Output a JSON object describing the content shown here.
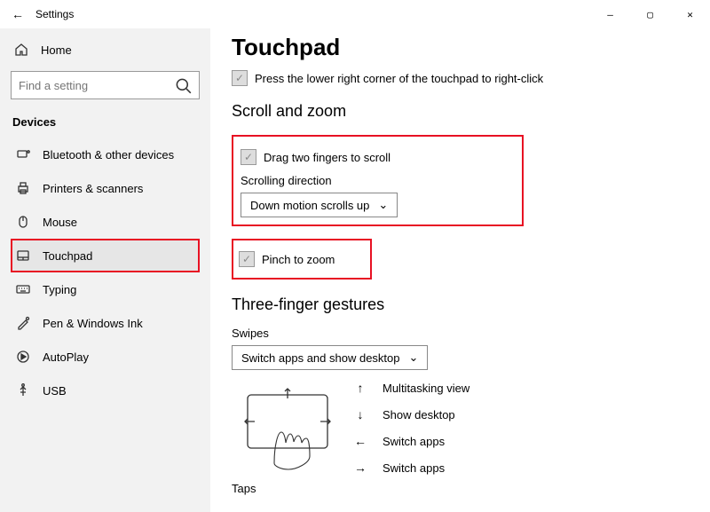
{
  "window": {
    "title": "Settings"
  },
  "sidebar": {
    "home": "Home",
    "searchPlaceholder": "Find a setting",
    "category": "Devices",
    "items": [
      {
        "l": "Bluetooth & other devices"
      },
      {
        "l": "Printers & scanners"
      },
      {
        "l": "Mouse"
      },
      {
        "l": "Touchpad"
      },
      {
        "l": "Typing"
      },
      {
        "l": "Pen & Windows Ink"
      },
      {
        "l": "AutoPlay"
      },
      {
        "l": "USB"
      }
    ]
  },
  "page": {
    "title": "Touchpad",
    "pressCorner": "Press the lower right corner of the touchpad to right-click",
    "scrollZoom": "Scroll and zoom",
    "dragTwo": "Drag two fingers to scroll",
    "scrollDirLabel": "Scrolling direction",
    "scrollDirValue": "Down motion scrolls up",
    "pinch": "Pinch to zoom",
    "threeFinger": "Three-finger gestures",
    "swipesLabel": "Swipes",
    "swipesValue": "Switch apps and show desktop",
    "gestures": [
      {
        "dir": "↑",
        "l": "Multitasking view"
      },
      {
        "dir": "↓",
        "l": "Show desktop"
      },
      {
        "dir": "←",
        "l": "Switch apps"
      },
      {
        "dir": "→",
        "l": "Switch apps"
      }
    ],
    "taps": "Taps"
  }
}
